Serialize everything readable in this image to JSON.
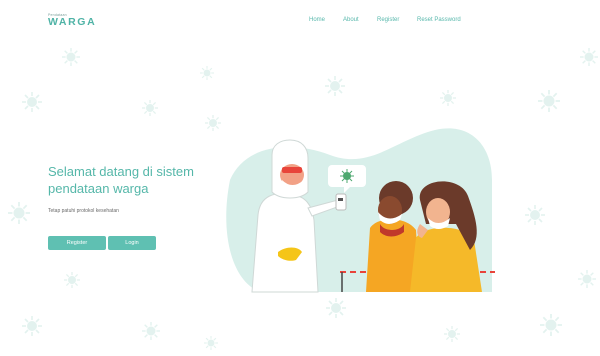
{
  "brand": {
    "tagline": "Pendataan",
    "name": "WARGA"
  },
  "nav": [
    {
      "label": "Home"
    },
    {
      "label": "About"
    },
    {
      "label": "Register"
    },
    {
      "label": "Reset Password"
    }
  ],
  "hero": {
    "title": "Selamat datang di sistem pendataan warga",
    "subtitle": "Tetap patuhi protokol kesehatan",
    "register_label": "Register",
    "login_label": "Login"
  },
  "colors": {
    "accent": "#5fc0b2",
    "accent_text": "#55b7a9",
    "virus": "#d9efe9",
    "illustration_bg": "#d8efea"
  },
  "icons": [
    "virus-icon",
    "health-worker-illustration"
  ]
}
